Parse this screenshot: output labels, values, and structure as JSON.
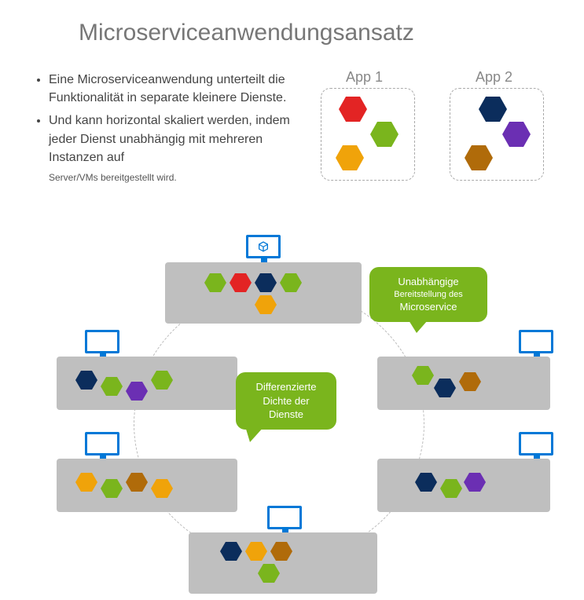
{
  "title": "Microserviceanwendungsansatz",
  "bullets": {
    "item1": "Eine Microserviceanwendung unterteilt die Funktionalität in separate kleinere Dienste.",
    "item2": "Und kann horizontal skaliert werden, indem jeder Dienst unabhängig mit mehreren Instanzen auf",
    "sub": "Server/VMs bereitgestellt wird."
  },
  "apps": {
    "label1": "App 1",
    "label2": "App 2"
  },
  "bubbles": {
    "independent": {
      "line1": "Unabhängige",
      "line2": "Bereitstellung des",
      "line3": "Microservice"
    },
    "density": {
      "line1": "Differenzierte",
      "line2": "Dichte der",
      "line3": "Dienste"
    }
  },
  "colors": {
    "red": "#e32424",
    "green": "#7ab51d",
    "yellow": "#f0a30a",
    "navy": "#0b2d5c",
    "purple": "#6b2fb3",
    "brown": "#b06b0a",
    "accent": "#0078d7",
    "server": "#bfbfbf"
  },
  "diagram": {
    "app1_services": [
      "red",
      "green",
      "yellow"
    ],
    "app2_services": [
      "navy",
      "purple",
      "brown"
    ],
    "servers": [
      {
        "pos": "top",
        "services": [
          "green",
          "red",
          "navy",
          "green",
          "yellow"
        ]
      },
      {
        "pos": "right-upper",
        "services": [
          "green",
          "navy",
          "brown"
        ]
      },
      {
        "pos": "right-lower",
        "services": [
          "navy",
          "green",
          "purple"
        ]
      },
      {
        "pos": "bottom",
        "services": [
          "navy",
          "yellow",
          "brown",
          "green"
        ]
      },
      {
        "pos": "left-lower",
        "services": [
          "yellow",
          "green",
          "brown",
          "yellow"
        ]
      },
      {
        "pos": "left-upper",
        "services": [
          "navy",
          "green",
          "purple",
          "green"
        ]
      }
    ]
  }
}
